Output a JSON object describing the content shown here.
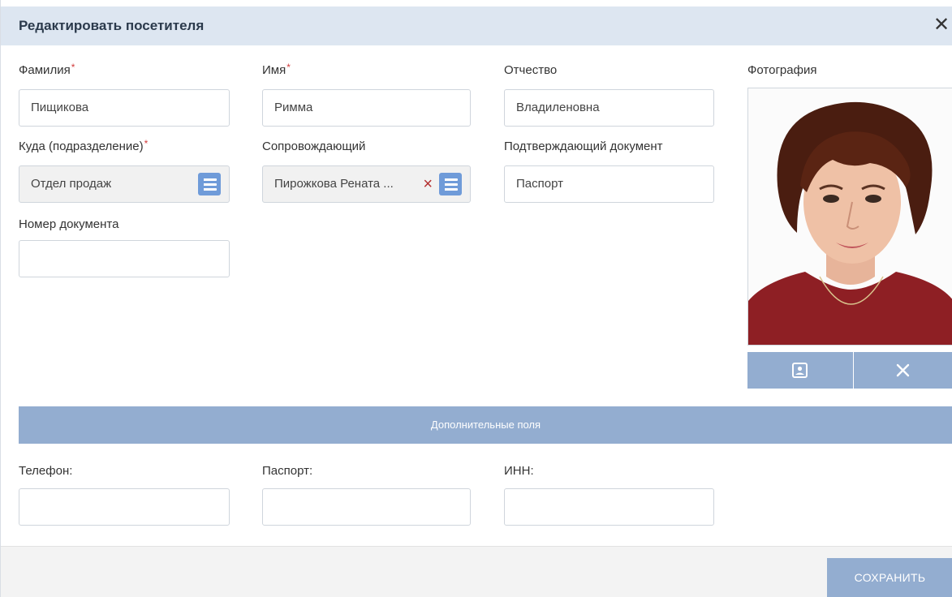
{
  "dialog": {
    "title": "Редактировать посетителя",
    "close_glyph": "✕"
  },
  "fields": {
    "last_name": {
      "label": "Фамилия",
      "required": "*",
      "value": "Пищикова"
    },
    "first_name": {
      "label": "Имя",
      "required": "*",
      "value": "Римма"
    },
    "patronymic": {
      "label": "Отчество",
      "value": "Владиленовна"
    },
    "department": {
      "label": "Куда (подразделение)",
      "required": "*",
      "value": "Отдел продаж"
    },
    "escort": {
      "label": "Сопровождающий",
      "value": "Пирожкова Рената ...",
      "clear_glyph": "×"
    },
    "document_type": {
      "label": "Подтверждающий документ",
      "value": "Паспорт"
    },
    "document_number": {
      "label": "Номер документа",
      "value": ""
    }
  },
  "photo": {
    "label": "Фотография"
  },
  "extra": {
    "section_title": "Дополнительные поля",
    "phone": {
      "label": "Телефон:",
      "value": ""
    },
    "passport": {
      "label": "Паспорт:",
      "value": ""
    },
    "inn": {
      "label": "ИНН:",
      "value": ""
    }
  },
  "footer": {
    "save_label": "СОХРАНИТЬ"
  },
  "colors": {
    "header_bg": "#dde6f1",
    "accent_button": "#93add0",
    "list_button": "#6f9bd9",
    "required_mark": "#d23b3b"
  }
}
